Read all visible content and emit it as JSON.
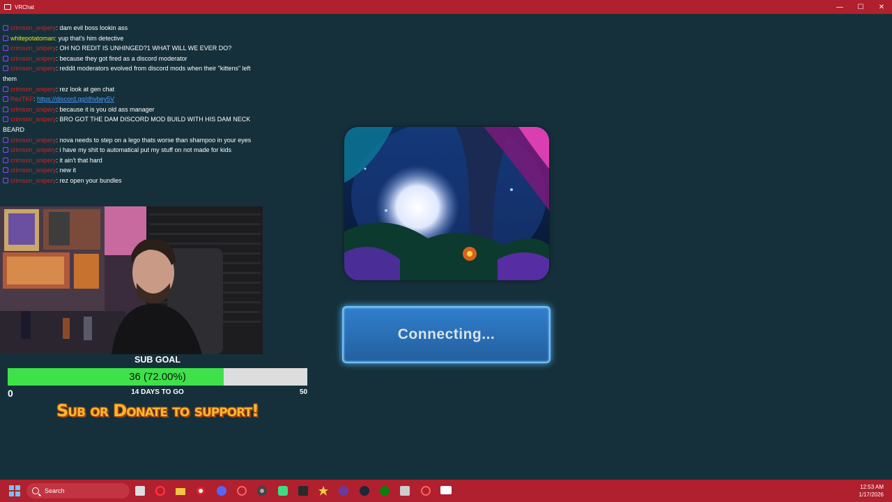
{
  "window": {
    "title": "VRChat",
    "controls": {
      "minimize": "—",
      "maximize": "☐",
      "close": "✕"
    }
  },
  "chat": {
    "messages": [
      {
        "user": "crimson_snipery",
        "user_color": "#e01e1e",
        "text": "dam evil boss lookin ass"
      },
      {
        "user": "whitepotatoman",
        "user_color": "#e8e81e",
        "text": "yup that's him detective"
      },
      {
        "user": "crimson_snipery",
        "user_color": "#e01e1e",
        "text": "OH NO REDIT IS UNHINGED?1 WHAT WILL WE EVER DO?"
      },
      {
        "user": "crimson_snipery",
        "user_color": "#e01e1e",
        "text": "because they got fired as a discord moderator"
      },
      {
        "user": "crimson_snipery",
        "user_color": "#e01e1e",
        "text": "reddit moderators evolved from discord mods when their \"kittens\" left them"
      },
      {
        "user": "crimson_snipery",
        "user_color": "#e01e1e",
        "text": "rez look at gen chat"
      },
      {
        "user": "RezTKF",
        "user_color": "#e01e1e",
        "link": "https://discord.gg/dhvbey5V"
      },
      {
        "user": "crimson_snipery",
        "user_color": "#e01e1e",
        "text": "because it is you old ass manager"
      },
      {
        "user": "crimson_snipery",
        "user_color": "#e01e1e",
        "text": "BRO GOT THE DAM DISCORD MOD BUILD WITH HIS DAM NECK BEARD"
      },
      {
        "user": "crimson_snipery",
        "user_color": "#e01e1e",
        "text": "nova needs to step on a lego thats worse than shampoo in your eyes"
      },
      {
        "user": "crimson_snipery",
        "user_color": "#e01e1e",
        "text": "i have my shit to automatical put my stuff on not made for kids"
      },
      {
        "user": "crimson_snipery",
        "user_color": "#e01e1e",
        "text": "it ain't that hard"
      },
      {
        "user": "crimson_snipery",
        "user_color": "#e01e1e",
        "text": "new it"
      },
      {
        "user": "crimson_snipery",
        "user_color": "#e01e1e",
        "text": "rez open your bundles"
      }
    ]
  },
  "sub_goal": {
    "title": "SUB GOAL",
    "progress_text": "36 (72.00%)",
    "progress_fraction": 0.72,
    "min": "0",
    "max": "50",
    "days_left": "14 DAYS TO GO",
    "banner": "Sub or Donate to support!"
  },
  "world": {
    "connect_label": "Connecting..."
  },
  "taskbar": {
    "search_placeholder": "Search",
    "time": "12:53 AM",
    "date": "1/17/2026",
    "icons": [
      "windows-start-icon",
      "file-explorer-icon",
      "opera-icon",
      "folder-icon",
      "record-icon",
      "discord-icon",
      "creative-cloud-icon",
      "chrome-icon",
      "android-icon",
      "terminal-icon",
      "star-icon",
      "firefox-icon",
      "steam-icon",
      "xbox-icon",
      "snipping-icon",
      "creative-cloud-icon-2",
      "vrchat-icon"
    ]
  }
}
